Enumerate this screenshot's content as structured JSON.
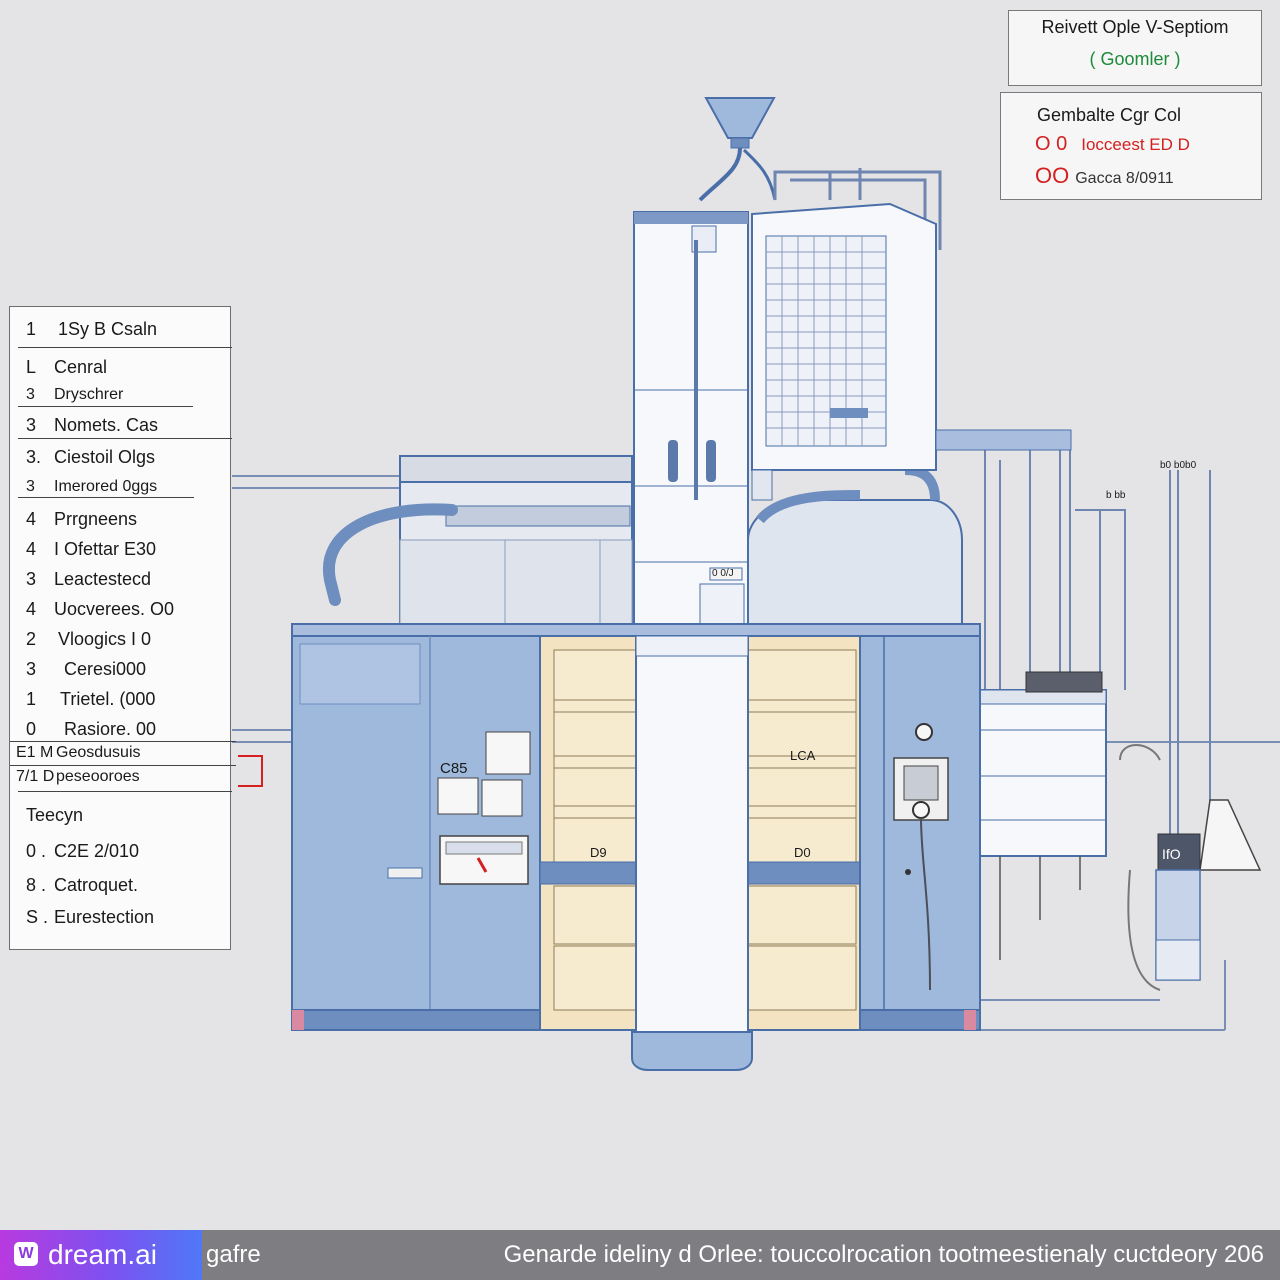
{
  "title_box": {
    "line1": "Reivett Ople  V-Septiom",
    "line2": "( Goomler )"
  },
  "info_box": {
    "heading": "Gembalte Cgr Col",
    "row1_code": "O 0",
    "row1_text": "Iocceest ED D",
    "row2_code": "OO",
    "row2_text": "Gacca 8/0911"
  },
  "legend": {
    "header_num": "1",
    "header_text": "1Sy B Csaln",
    "items": [
      {
        "num": "L",
        "text": "Cenral"
      },
      {
        "num": "3",
        "text": "Dryschrer"
      },
      {
        "num": "3",
        "text": "Nomets. Cas"
      },
      {
        "num": "3.",
        "text": "Ciestoil Olgs"
      },
      {
        "num": "3",
        "text": "Imerored 0ggs"
      },
      {
        "num": "4",
        "text": "Prrgneens"
      },
      {
        "num": "4",
        "text": "I Ofettar E30"
      },
      {
        "num": "3",
        "text": "Leactestecd"
      },
      {
        "num": "4",
        "text": "Uocverees. O0"
      },
      {
        "num": "2",
        "text": "Vloogics I 0"
      },
      {
        "num": "3",
        "text": "Ceresi000"
      },
      {
        "num": "1",
        "text": "Trietel. (000"
      },
      {
        "num": "0",
        "text": "Rasiore. 00"
      },
      {
        "num": "E1 M",
        "text": "Geosdusuis"
      },
      {
        "num": "7/1 D",
        "text": "peseooroes"
      }
    ],
    "footer_title": "Teecyn",
    "footer_items": [
      {
        "num": "0 .",
        "text": "C2E 2/010"
      },
      {
        "num": "8 .",
        "text": "Catroquet."
      },
      {
        "num": "S .",
        "text": "Eurestection"
      }
    ]
  },
  "diagram_labels": {
    "panel_label": "C85",
    "mid_label": "0 0/J",
    "drawer_left": "D9",
    "drawer_right": "D0",
    "lca": "LCA",
    "small_top_right": "b0 b0b0",
    "right_tag": "b bb",
    "canister": "IfO"
  },
  "footer": {
    "brand": "dream.ai",
    "brand_mark": "W",
    "tail": "gafre",
    "caption": "Genarde ideliny d Orlee: touccolrocation tootmeestienaly cuctdeory 206"
  },
  "colors": {
    "background": "#e4e4e6",
    "cabinet_blue": "#9fb9dc",
    "outline_blue": "#4a6fa8",
    "cream": "#f3e3c0",
    "accent_red": "#d42020",
    "accent_green": "#1e8a3a"
  }
}
